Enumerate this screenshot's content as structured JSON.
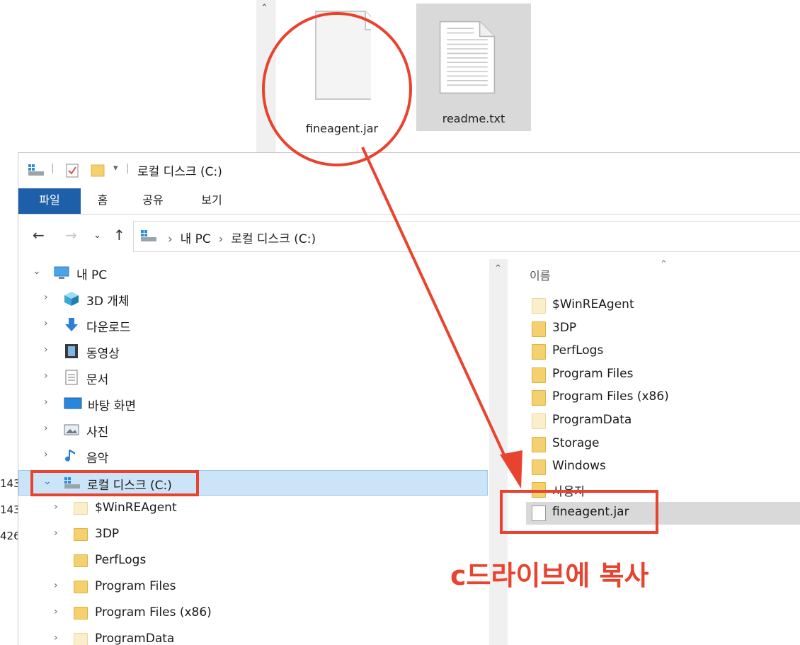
{
  "top_window": {
    "files": [
      {
        "name": "fineagent.jar",
        "icon": "blank-file-icon"
      },
      {
        "name": "readme.txt",
        "icon": "text-file-icon"
      }
    ]
  },
  "left_fragment": [
    "143",
    "143",
    "426"
  ],
  "explorer": {
    "title": "로컬 디스크 (C:)",
    "ribbon_tabs": [
      "파일",
      "홈",
      "공유",
      "보기"
    ],
    "address": {
      "crumbs": [
        "내 PC",
        "로컬 디스크 (C:)"
      ]
    },
    "nav_tree": [
      {
        "label": "내 PC",
        "icon": "computer-icon",
        "expanded": true
      },
      {
        "label": "3D 개체",
        "icon": "cube-3d-icon"
      },
      {
        "label": "다운로드",
        "icon": "download-arrow-icon"
      },
      {
        "label": "동영상",
        "icon": "video-icon"
      },
      {
        "label": "문서",
        "icon": "document-icon"
      },
      {
        "label": "바탕 화면",
        "icon": "desktop-icon"
      },
      {
        "label": "사진",
        "icon": "pictures-icon"
      },
      {
        "label": "음악",
        "icon": "music-note-icon"
      },
      {
        "label": "로컬 디스크 (C:)",
        "icon": "drive-icon",
        "expanded": true,
        "selected": true
      },
      {
        "label": "$WinREAgent",
        "icon": "folder-icon"
      },
      {
        "label": "3DP",
        "icon": "folder-icon"
      },
      {
        "label": "PerfLogs",
        "icon": "folder-icon"
      },
      {
        "label": "Program Files",
        "icon": "folder-icon"
      },
      {
        "label": "Program Files (x86)",
        "icon": "folder-icon"
      },
      {
        "label": "ProgramData",
        "icon": "folder-icon"
      }
    ],
    "list_header": "이름",
    "files": [
      {
        "name": "$WinREAgent",
        "type": "folder-light"
      },
      {
        "name": "3DP",
        "type": "folder"
      },
      {
        "name": "PerfLogs",
        "type": "folder"
      },
      {
        "name": "Program Files",
        "type": "folder"
      },
      {
        "name": "Program Files (x86)",
        "type": "folder"
      },
      {
        "name": "ProgramData",
        "type": "folder-light"
      },
      {
        "name": "Storage",
        "type": "folder"
      },
      {
        "name": "Windows",
        "type": "folder"
      },
      {
        "name": "사용자",
        "type": "folder"
      },
      {
        "name": "fineagent.jar",
        "type": "file"
      }
    ]
  },
  "annotation": {
    "label": "c드라이브에 복사",
    "color": "#e8432e"
  },
  "colors": {
    "ribbon_file_tab": "#1d5fa8",
    "selection": "#cce4f7"
  }
}
